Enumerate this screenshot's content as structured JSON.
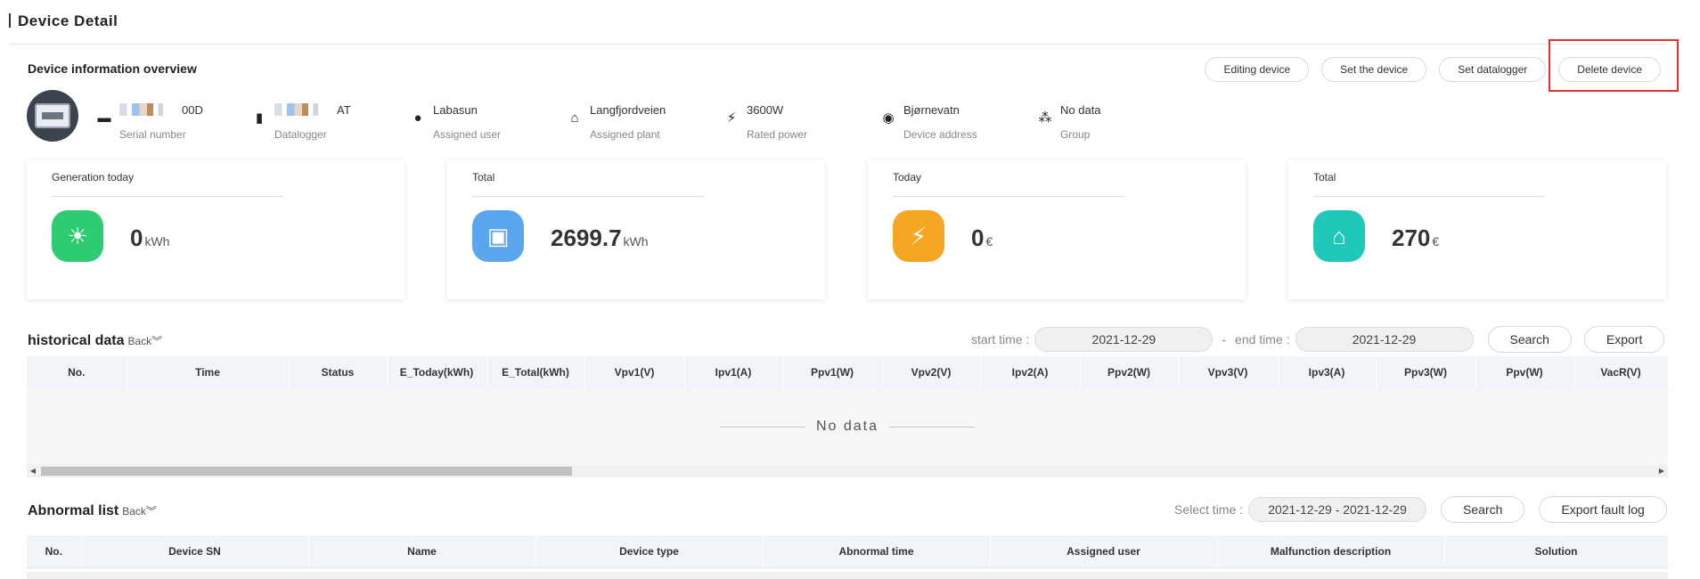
{
  "page": {
    "title": "Device Detail"
  },
  "overview": {
    "title": "Device information overview",
    "actions": [
      "Editing device",
      "Set the device",
      "Set datalogger",
      "Delete device"
    ],
    "info": [
      {
        "icon": "inverter-icon",
        "value": "00D",
        "label": "Serial number"
      },
      {
        "icon": "datalogger-icon",
        "value": "AT",
        "label": "Datalogger"
      },
      {
        "icon": "user-icon",
        "value": "Labasun",
        "label": "Assigned user"
      },
      {
        "icon": "plant-icon",
        "value": "Langfjordveien",
        "label": "Assigned plant"
      },
      {
        "icon": "lightning-icon",
        "value": "3600W",
        "label": "Rated power"
      },
      {
        "icon": "location-pin-icon",
        "value": "Bjørnevatn",
        "label": "Device address"
      },
      {
        "icon": "group-icon",
        "value": "No data",
        "label": "Group"
      }
    ]
  },
  "cards": [
    {
      "title": "Generation today",
      "value": "0",
      "unit": "kWh",
      "icon": "solar-energy-icon",
      "color": "#2ecc71"
    },
    {
      "title": "Total",
      "value": "2699.7",
      "unit": "kWh",
      "icon": "battery-icon",
      "color": "#5aa7f0"
    },
    {
      "title": "Today",
      "value": "0",
      "unit": "€",
      "icon": "power-tower-icon",
      "color": "#f5a623"
    },
    {
      "title": "Total",
      "value": "270",
      "unit": "€",
      "icon": "home-icon",
      "color": "#1fc8b8"
    }
  ],
  "historical": {
    "title": "historical data",
    "back": "Back",
    "start_label": "start time :",
    "start_value": "2021-12-29",
    "dash": "-",
    "end_label": "end time :",
    "end_value": "2021-12-29",
    "search": "Search",
    "export": "Export",
    "columns": [
      "No.",
      "Time",
      "Status",
      "E_Today(kWh)",
      "E_Total(kWh)",
      "Vpv1(V)",
      "Ipv1(A)",
      "Ppv1(W)",
      "Vpv2(V)",
      "Ipv2(A)",
      "Ppv2(W)",
      "Vpv3(V)",
      "Ipv3(A)",
      "Ppv3(W)",
      "Ppv(W)",
      "VacR(V)"
    ],
    "empty": "No data"
  },
  "abnormal": {
    "title": "Abnormal list",
    "back": "Back",
    "select_label": "Select time :",
    "range_value": "2021-12-29 - 2021-12-29",
    "search": "Search",
    "export": "Export fault log",
    "columns": [
      "No.",
      "Device SN",
      "Name",
      "Device type",
      "Abnormal time",
      "Assigned user",
      "Malfunction description",
      "Solution"
    ]
  },
  "colors": {
    "highlight": "#e4312f",
    "header_bg": "#f1f5f9"
  }
}
